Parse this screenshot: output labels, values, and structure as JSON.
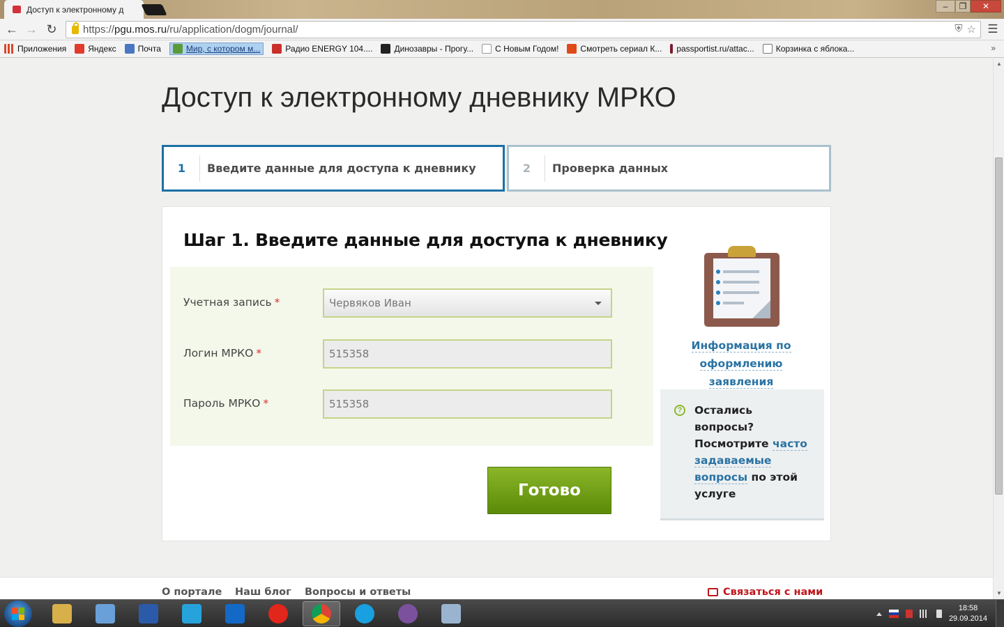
{
  "browser": {
    "tab_title": "Доступ к электронному д",
    "url_scheme": "https://",
    "url_host": "pgu.mos.ru",
    "url_path": "/ru/application/dogm/journal/",
    "window_min": "‒",
    "window_max": "❐",
    "window_close": "✕"
  },
  "bookmarks": [
    {
      "label": "Приложения",
      "color": "#d9482b"
    },
    {
      "label": "Яндекс",
      "color": "#e23a2f"
    },
    {
      "label": "Почта",
      "color": "#4a77c4"
    },
    {
      "label": "Мир, с котором м...",
      "color": "#5a9b38"
    },
    {
      "label": "Радио ENERGY 104....",
      "color": "#c9302c"
    },
    {
      "label": "Динозавры - Прогу...",
      "color": "#222222"
    },
    {
      "label": "С Новым Годом!",
      "color": "#ffffff"
    },
    {
      "label": "Смотреть сериал К...",
      "color": "#e04a1a"
    },
    {
      "label": "passportist.ru/attac...",
      "color": "#7a1b2d"
    },
    {
      "label": "Корзинка с яблока...",
      "color": "#ffffff"
    }
  ],
  "page": {
    "title": "Доступ к электронному дневнику МРКО",
    "steps": [
      {
        "number": "1",
        "label": "Введите данные для доступа к дневнику",
        "active": true
      },
      {
        "number": "2",
        "label": "Проверка данных",
        "active": false
      }
    ],
    "card_title": "Шаг 1. Введите данные для доступа к дневнику",
    "form": {
      "required_mark": "*",
      "account_label": "Учетная запись",
      "account_value": "Червяков Иван",
      "login_label": "Логин МРКО",
      "login_value": "515358",
      "password_label": "Пароль МРКО",
      "password_value": "515358"
    },
    "submit_label": "Готово",
    "info_link_line1": "Информация по",
    "info_link_line2": "оформлению заявления",
    "help": {
      "icon": "?",
      "text_before": "Остались вопросы? Посмотрите",
      "link": "часто задаваемые вопросы",
      "text_after": "по этой услуге"
    }
  },
  "footer": {
    "links": [
      "О портале",
      "Наш блог",
      "Вопросы и ответы"
    ],
    "contact": "Связаться с нами"
  },
  "taskbar": {
    "apps": [
      {
        "name": "explorer",
        "color": "#d8b04a"
      },
      {
        "name": "scanner",
        "color": "#6aa0d8"
      },
      {
        "name": "word",
        "color": "#2b5aa8"
      },
      {
        "name": "zoner",
        "color": "#27a3dc"
      },
      {
        "name": "teamviewer",
        "color": "#1469c7"
      },
      {
        "name": "yandex-browser",
        "color": "#e1261c"
      },
      {
        "name": "chrome",
        "color": "#3d9c3f"
      },
      {
        "name": "skype",
        "color": "#18a0e0"
      },
      {
        "name": "viber",
        "color": "#7b519d"
      },
      {
        "name": "paint",
        "color": "#9ab4d0"
      }
    ],
    "time": "18:58",
    "date": "29.09.2014"
  }
}
